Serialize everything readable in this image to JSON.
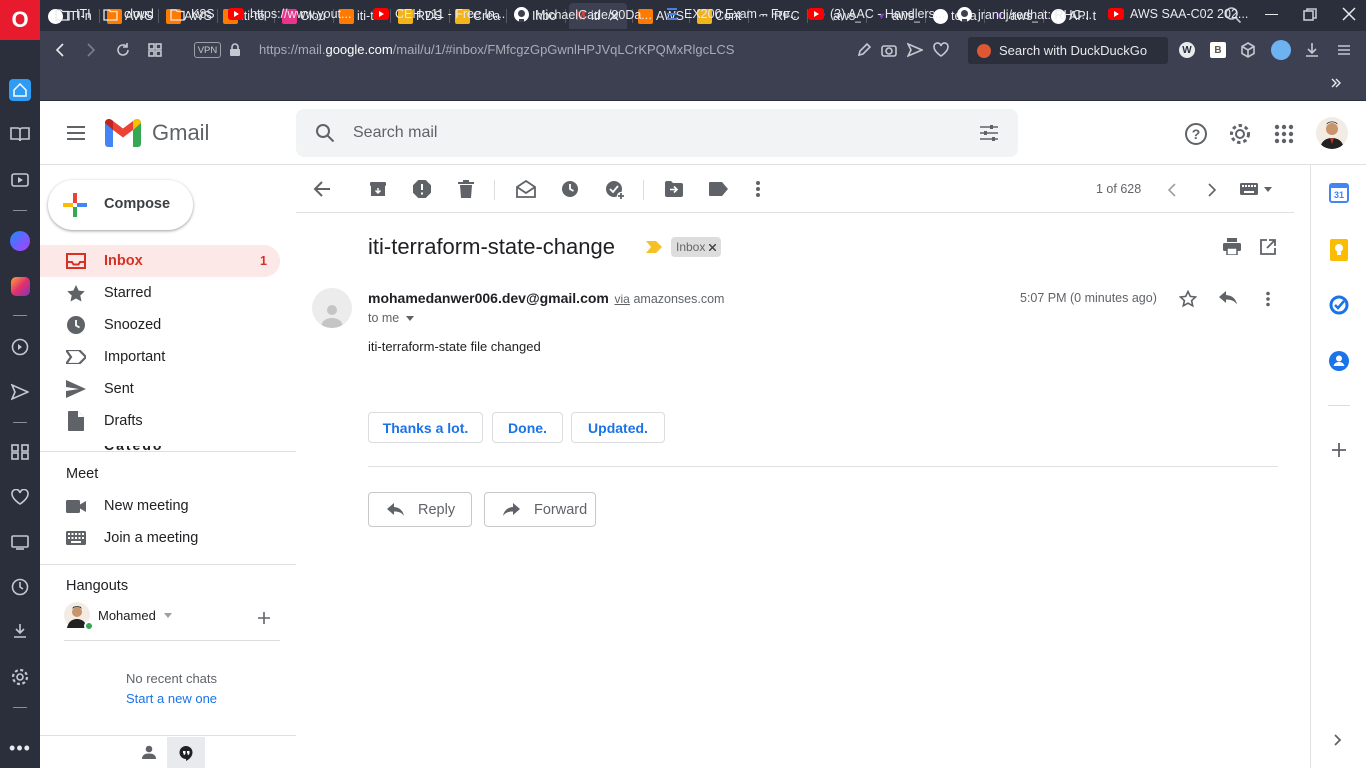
{
  "browser": {
    "tabs": [
      {
        "label": "ITI-n",
        "icon": "github-icon",
        "color": "#ffffff"
      },
      {
        "label": "AWS",
        "icon": "aws-icon",
        "color": "#ff7a00"
      },
      {
        "label": "AWS",
        "icon": "aws-icon",
        "color": "#ff7a00"
      },
      {
        "label": "iti-te",
        "icon": "lambda-icon",
        "color": "#ff7a00"
      },
      {
        "label": "Clou",
        "icon": "cloud-icon",
        "color": "#e6358a"
      },
      {
        "label": "iti-te",
        "icon": "aws-icon",
        "color": "#ff7a00"
      },
      {
        "label": "RDS",
        "icon": "box-icon",
        "color": "#f2b31b"
      },
      {
        "label": "Crea",
        "icon": "box-icon",
        "color": "#f2b31b"
      },
      {
        "label": "Inbo",
        "icon": "gmail-icon",
        "color": "#ea4335"
      },
      {
        "label": "iti",
        "icon": "gmail-icon",
        "color": "#ea4335"
      },
      {
        "label": "AWS",
        "icon": "aws-icon",
        "color": "#ff7a00"
      },
      {
        "label": "Cont",
        "icon": "box-icon",
        "color": "#f2b31b"
      },
      {
        "label": "RFC",
        "icon": "rfc-icon",
        "color": "#cccccc"
      },
      {
        "label": "aws_",
        "icon": "terraform-icon",
        "color": "#7b42bc"
      },
      {
        "label": "aws_",
        "icon": "terraform-icon",
        "color": "#7b42bc"
      },
      {
        "label": "terra",
        "icon": "github-icon",
        "color": "#ffffff"
      },
      {
        "label": "aws_",
        "icon": "terraform-icon",
        "color": "#7b42bc"
      },
      {
        "label": "API t",
        "icon": "github-icon",
        "color": "#ffffff"
      }
    ],
    "url_prefix": "https://mail.",
    "url_domain": "google.com",
    "url_path": "/mail/u/1/#inbox/FMfcgzGpGwnlHPJVqLCrKPQMxRlgcLCS",
    "vpn_label": "VPN",
    "search_placeholder": "Search with DuckDuckGo",
    "bookmarks": [
      {
        "label": "ITI",
        "icon": "folder-icon"
      },
      {
        "label": "cloud",
        "icon": "folder-icon"
      },
      {
        "label": "K8S",
        "icon": "folder-icon"
      },
      {
        "label": "https://www.yout...",
        "icon": "youtube-icon"
      },
      {
        "label": "CEH v11 - Free In...",
        "icon": "youtube-icon"
      },
      {
        "label": "MichaelCade/90Da...",
        "icon": "github-icon"
      },
      {
        "label": "EX200 Exam – Fre...",
        "icon": "list-icon"
      },
      {
        "label": "(3) AAC - Handlers...",
        "icon": "youtube-icon"
      },
      {
        "label": "jrandj/redhat: RHC...",
        "icon": "github-icon"
      },
      {
        "label": "AWS SAA-C02 202...",
        "icon": "youtube-icon"
      }
    ]
  },
  "gmail": {
    "brand": "Gmail",
    "search_placeholder": "Search mail",
    "compose_label": "Compose",
    "nav": [
      {
        "label": "Inbox",
        "count": "1",
        "icon": "inbox-icon"
      },
      {
        "label": "Starred",
        "count": "",
        "icon": "star-icon"
      },
      {
        "label": "Snoozed",
        "count": "",
        "icon": "clock-icon"
      },
      {
        "label": "Important",
        "count": "",
        "icon": "important-icon"
      },
      {
        "label": "Sent",
        "count": "",
        "icon": "send-icon"
      },
      {
        "label": "Drafts",
        "count": "",
        "icon": "draft-icon"
      }
    ],
    "meet_title": "Meet",
    "meet_items": [
      {
        "label": "New meeting",
        "icon": "video-icon"
      },
      {
        "label": "Join a meeting",
        "icon": "keyboard-icon"
      }
    ],
    "hangouts_title": "Hangouts",
    "hangouts_user": "Mohamed",
    "no_chats": "No recent chats",
    "start_new": "Start a new one",
    "pager": "1 of 628",
    "email": {
      "subject": "iti-terraform-state-change",
      "label": "Inbox",
      "sender": "mohamedanwer006.dev@gmail.com",
      "via": "via",
      "via_domain": "amazonses.com",
      "to": "to me",
      "time": "5:07 PM (0 minutes ago)",
      "body": "iti-terraform-state file changed",
      "smart_replies": [
        "Thanks a lot.",
        "Done.",
        "Updated."
      ],
      "reply_label": "Reply",
      "forward_label": "Forward"
    },
    "colors": {
      "accent_blue": "#1a73e8",
      "inbox_red": "#d93025",
      "label_yellow": "#f6c026"
    }
  }
}
